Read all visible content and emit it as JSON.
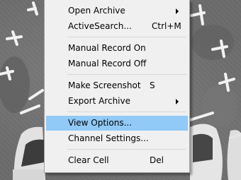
{
  "background": {
    "description_icon": "cctv-parking-lot-feed"
  },
  "menu": {
    "items": [
      {
        "label": "Open Archive",
        "shortcut": "",
        "submenu": true
      },
      {
        "label": "ActiveSearch...",
        "shortcut": "Ctrl+M",
        "submenu": false
      },
      {
        "label": "Manual Record On",
        "shortcut": "",
        "submenu": false
      },
      {
        "label": "Manual Record Off",
        "shortcut": "",
        "submenu": false
      },
      {
        "label": "Make Screenshot",
        "shortcut": "S",
        "submenu": false
      },
      {
        "label": "Export Archive",
        "shortcut": "",
        "submenu": true
      },
      {
        "label": "View Options...",
        "shortcut": "",
        "submenu": false,
        "highlighted": true
      },
      {
        "label": "Channel Settings...",
        "shortcut": "",
        "submenu": false
      },
      {
        "label": "Clear Cell",
        "shortcut": "Del",
        "submenu": false
      }
    ]
  },
  "colors": {
    "menu_background": "#f0f0f0",
    "highlight": "#91c9f7",
    "separator": "#d7d7d7"
  }
}
